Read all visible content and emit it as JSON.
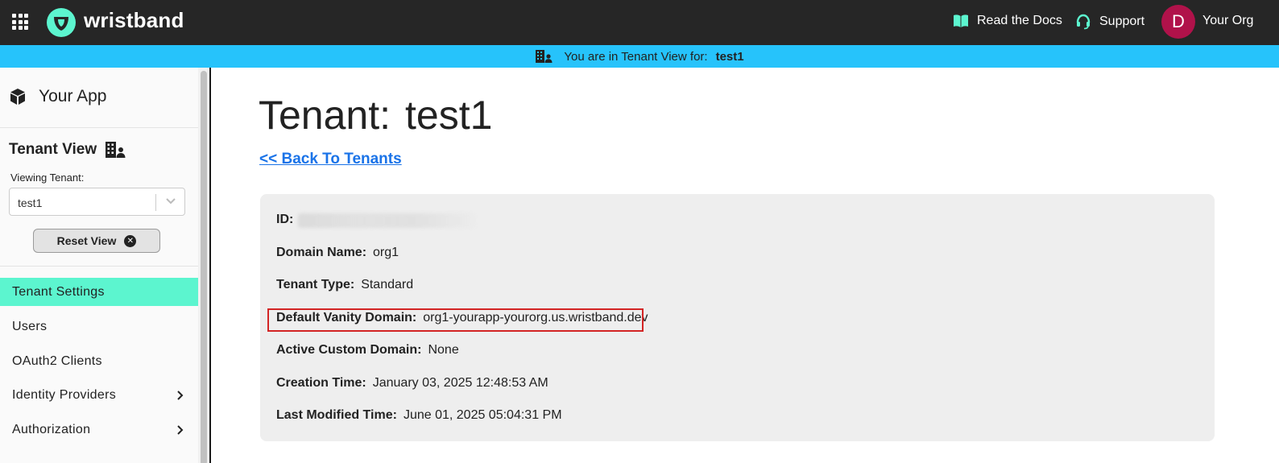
{
  "topbar": {
    "brand": "wristband",
    "docs_label": "Read the Docs",
    "support_label": "Support",
    "avatar_initial": "D",
    "org_name": "Your Org",
    "brand_color": "#5cf5cf",
    "avatar_color": "#b0124a"
  },
  "banner": {
    "text": "You are in Tenant View for:",
    "tenant": "test1",
    "color": "#26c3fb"
  },
  "sidebar": {
    "app_name": "Your App",
    "tenant_view_title": "Tenant View",
    "viewing_label": "Viewing Tenant:",
    "selected_tenant": "test1",
    "reset_label": "Reset View",
    "nav": [
      {
        "label": "Tenant Settings",
        "active": true
      },
      {
        "label": "Users"
      },
      {
        "label": "OAuth2 Clients"
      },
      {
        "label": "Identity Providers",
        "expandable": true
      },
      {
        "label": "Authorization",
        "expandable": true
      }
    ]
  },
  "main": {
    "title_prefix": "Tenant:",
    "title_tenant": "test1",
    "back_link": "<< Back To Tenants",
    "fields": [
      {
        "label": "ID:",
        "value": ""
      },
      {
        "label": "Domain Name:",
        "value": "org1"
      },
      {
        "label": "Tenant Type:",
        "value": "Standard"
      },
      {
        "label": "Default Vanity Domain:",
        "value": "org1-yourapp-yourorg.us.wristband.dev",
        "highlighted": true
      },
      {
        "label": "Active Custom Domain:",
        "value": "None"
      },
      {
        "label": "Creation Time:",
        "value": "January 03, 2025 12:48:53 AM"
      },
      {
        "label": "Last Modified Time:",
        "value": "June 01, 2025 05:04:31 PM"
      }
    ]
  }
}
